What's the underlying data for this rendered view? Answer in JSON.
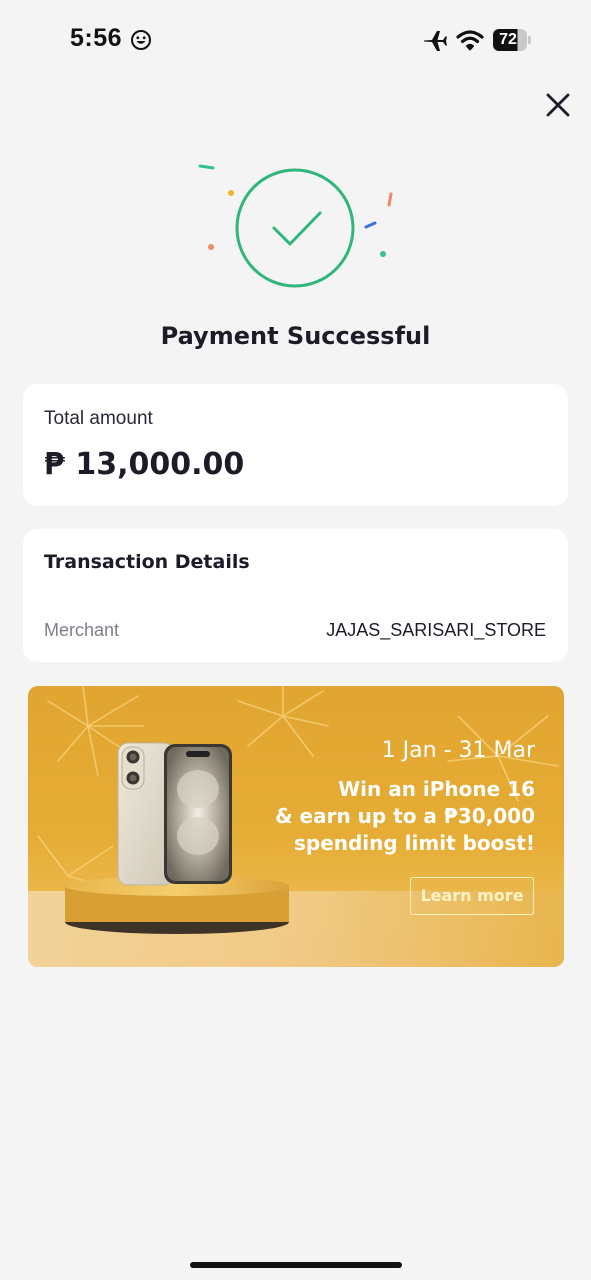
{
  "status_bar": {
    "time": "5:56",
    "battery": "72",
    "icons": [
      "smiley-icon",
      "airplane-icon",
      "wifi-icon",
      "battery-icon"
    ]
  },
  "header": {
    "close_icon": "close-icon"
  },
  "success": {
    "title": "Payment Successful",
    "icon": "check-circle-icon",
    "accent_color": "#2fb67a"
  },
  "amount_card": {
    "label": "Total amount",
    "value": "₱ 13,000.00"
  },
  "transaction_details": {
    "title": "Transaction Details",
    "rows": [
      {
        "label": "Merchant",
        "value": "JAJAS_SARISARI_STORE"
      }
    ]
  },
  "promo": {
    "dates": "1 Jan - 31 Mar",
    "headline_lines": [
      "Win an iPhone 16",
      "& earn up to a ₱30,000",
      "spending limit boost!"
    ],
    "button_label": "Learn more",
    "background_color": "#e3a933"
  }
}
